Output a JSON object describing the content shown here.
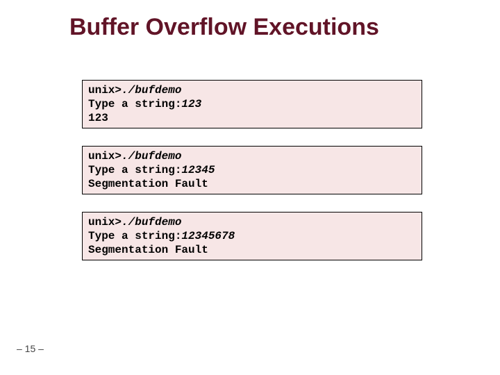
{
  "title": "Buffer Overflow Executions",
  "boxes": [
    {
      "prompt": "unix>",
      "cmd": "./bufdemo",
      "line2_label": "Type a string:",
      "line2_value": "123",
      "line3": "123"
    },
    {
      "prompt": "unix>",
      "cmd": "./bufdemo",
      "line2_label": "Type a string:",
      "line2_value": "12345",
      "line3": "Segmentation Fault"
    },
    {
      "prompt": "unix>",
      "cmd": "./bufdemo",
      "line2_label": "Type a string:",
      "line2_value": "12345678",
      "line3": "Segmentation Fault"
    }
  ],
  "footer": "– 15 –"
}
